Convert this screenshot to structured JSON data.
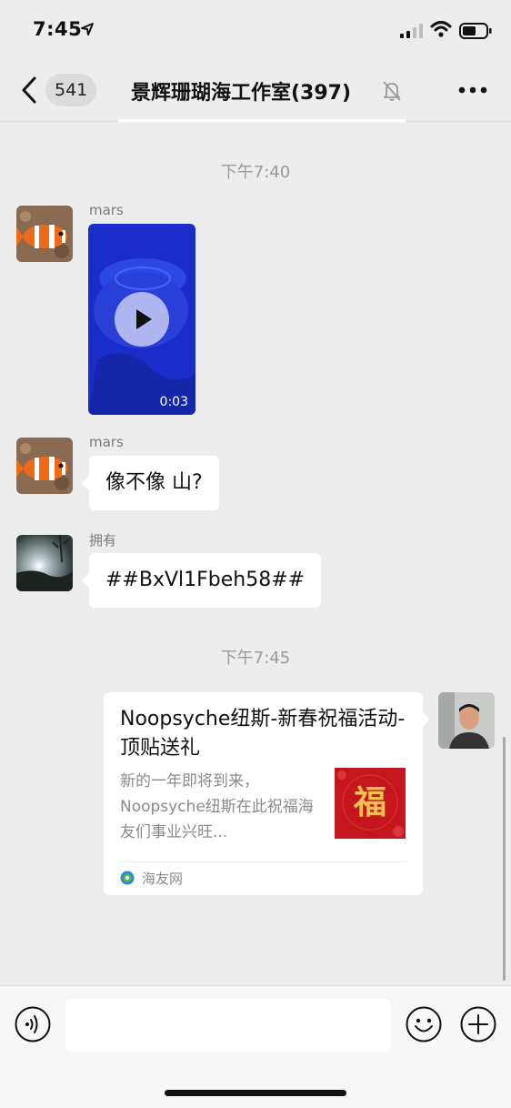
{
  "status_bar": {
    "time": "7:45"
  },
  "nav": {
    "badge": "541",
    "title": "景辉珊瑚海工作室(397)"
  },
  "timestamps": [
    "下午7:40",
    "下午7:45"
  ],
  "messages": [
    {
      "sender": "mars",
      "type": "video",
      "duration": "0:03"
    },
    {
      "sender": "mars",
      "type": "text",
      "text": "像不像 山?"
    },
    {
      "sender": "拥有",
      "type": "text",
      "text": "##BxVl1Fbeh58##"
    }
  ],
  "link_card": {
    "title": "Noopsyche纽斯-新春祝福活动-顶贴送礼",
    "description": "新的一年即将到来，Noopsyche纽斯在此祝福海友们事业兴旺...",
    "source": "海友网",
    "thumb_glyph": "福"
  },
  "colors": {
    "background": "#ededed",
    "bubble": "#ffffff",
    "thumb_red": "#c4161c",
    "video_blue": "#1a2cc9"
  },
  "icons": [
    "back-icon",
    "bell-mute-icon",
    "more-icon",
    "voice-icon",
    "emoji-icon",
    "plus-icon",
    "play-icon",
    "signal-icon",
    "wifi-icon",
    "battery-icon",
    "location-arrow-icon"
  ]
}
